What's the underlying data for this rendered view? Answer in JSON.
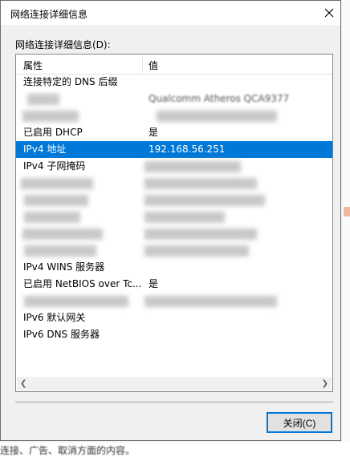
{
  "window": {
    "title": "网络连接详细信息"
  },
  "group_label": "网络连接详细信息(D):",
  "columns": {
    "property": "属性",
    "value": "值"
  },
  "rows": [
    {
      "property": "连接特定的 DNS 后缀",
      "value": ""
    },
    {
      "property": "",
      "value": "Qualcomm Atheros QCA9377"
    },
    {
      "property": "",
      "value": ""
    },
    {
      "property": "已启用 DHCP",
      "value": "是"
    },
    {
      "property": "IPv4 地址",
      "value": "192.168.56.251",
      "selected": true
    },
    {
      "property": "IPv4 子网掩码",
      "value": ""
    },
    {
      "property": "",
      "value": ""
    },
    {
      "property": "",
      "value": ""
    },
    {
      "property": "",
      "value": ""
    },
    {
      "property": "",
      "value": ""
    },
    {
      "property": "",
      "value": ""
    },
    {
      "property": "IPv4 WINS 服务器",
      "value": ""
    },
    {
      "property": "已启用 NetBIOS over Tc...",
      "value": "是"
    },
    {
      "property": "",
      "value": ""
    },
    {
      "property": "IPv6 默认网关",
      "value": ""
    },
    {
      "property": "IPv6 DNS 服务器",
      "value": ""
    }
  ],
  "buttons": {
    "close": "关闭(C)"
  },
  "colors": {
    "selection": "#0078d7",
    "button_border": "#0078d7"
  },
  "icons": {
    "close": "close-icon",
    "scroll_left": "scroll-left-arrow-icon",
    "scroll_right": "scroll-right-arrow-icon"
  },
  "background": {
    "text": "连接、广告、取消方面的内容。"
  }
}
